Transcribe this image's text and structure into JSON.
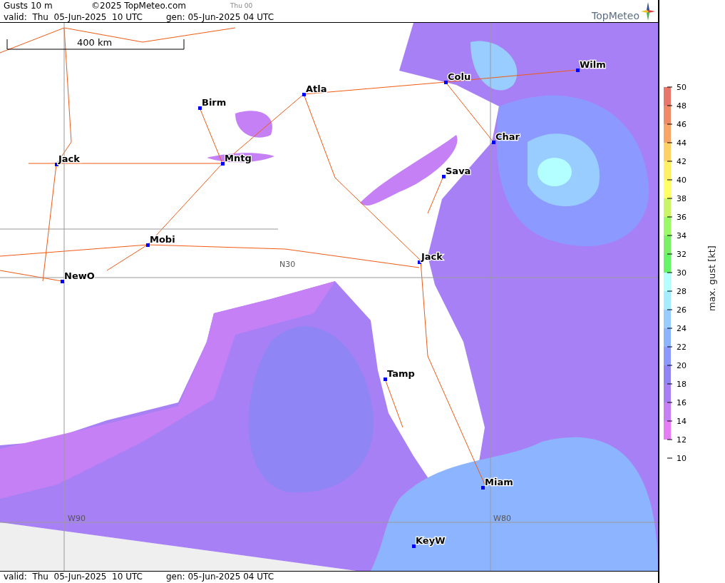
{
  "header": {
    "title": "Gusts 10 m",
    "copyright": "©2025 TopMeteo.com",
    "time_hint": "Thu 00",
    "valid": "valid:  Thu  05-Jun-2025  10 UTC",
    "generated": "gen: 05-Jun-2025 04 UTC",
    "logo_text": "TopMeteo"
  },
  "map": {
    "scale_label": "400 km",
    "grid_labels": [
      "N30",
      "W90",
      "W80"
    ],
    "cities": [
      {
        "name": "Colu"
      },
      {
        "name": "Wilm"
      },
      {
        "name": "Atla"
      },
      {
        "name": "Birm"
      },
      {
        "name": "Char"
      },
      {
        "name": "Jack"
      },
      {
        "name": "Mntg"
      },
      {
        "name": "Sava"
      },
      {
        "name": "Mobi"
      },
      {
        "name": "Jack"
      },
      {
        "name": "NewO"
      },
      {
        "name": "Tamp"
      },
      {
        "name": "Miam"
      },
      {
        "name": "KeyW"
      }
    ]
  },
  "footer": {
    "valid": "valid:  Thu  05-Jun-2025  10 UTC",
    "generated": "gen: 05-Jun-2025 04 UTC"
  },
  "legend": {
    "title": "max. gust [kt]",
    "bands": [
      {
        "color": "#e9766a"
      },
      {
        "color": "#f08a66"
      },
      {
        "color": "#f8a566"
      },
      {
        "color": "#fdd166"
      },
      {
        "color": "#fff066"
      },
      {
        "color": "#ffff66"
      },
      {
        "color": "#c9f566"
      },
      {
        "color": "#99fa66"
      },
      {
        "color": "#7af066"
      },
      {
        "color": "#66f566"
      },
      {
        "color": "#b3ffff"
      },
      {
        "color": "#a6ecff"
      },
      {
        "color": "#99ccff"
      },
      {
        "color": "#8db4ff"
      },
      {
        "color": "#8c99ff"
      },
      {
        "color": "#8f85f5"
      },
      {
        "color": "#a880f5"
      },
      {
        "color": "#c680f5"
      },
      {
        "color": "#e57ef5"
      }
    ],
    "ticks": [
      "50",
      "48",
      "46",
      "44",
      "42",
      "40",
      "38",
      "36",
      "34",
      "32",
      "30",
      "28",
      "26",
      "24",
      "22",
      "20",
      "18",
      "16",
      "14",
      "12",
      "10"
    ]
  }
}
